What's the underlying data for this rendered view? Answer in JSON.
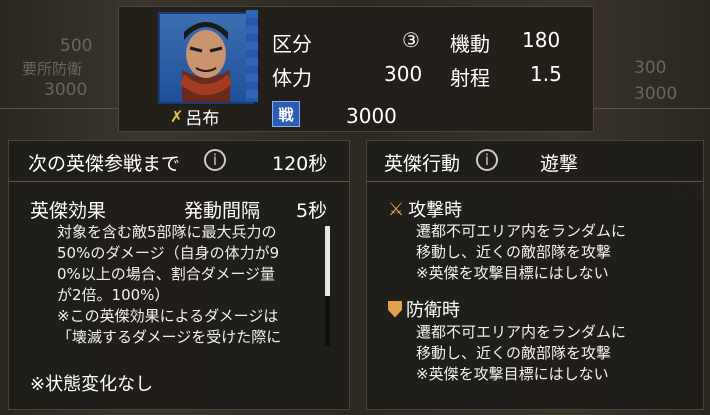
{
  "top": {
    "class_label": "区分",
    "class_value": "③",
    "mobility_label": "機動",
    "mobility_value": "180",
    "hp_label": "体力",
    "hp_value": "300",
    "range_label": "射程",
    "range_value": "1.5",
    "unit_name": "呂布",
    "war_badge": "戦",
    "war_value": "3000"
  },
  "left_panel": {
    "header_label": "次の英傑参戦まで",
    "header_value": "120秒",
    "effect_title": "英傑効果",
    "interval_label": "発動間隔",
    "interval_value": "5秒",
    "desc_lines": [
      "対象を含む敵5部隊に最大兵力の",
      "50%のダメージ（自身の体力が9",
      "0%以上の場合、割合ダメージ量",
      "が2倍。100%）",
      "※この英傑効果によるダメージは",
      "「壊滅するダメージを受けた際に"
    ],
    "status_note": "※状態変化なし"
  },
  "right_panel": {
    "header_label": "英傑行動",
    "header_value": "遊撃",
    "attack_title": "攻撃時",
    "attack_lines": [
      "遷都不可エリア内をランダムに",
      "移動し、近くの敵部隊を攻撃",
      "※英傑を攻撃目標にはしない"
    ],
    "defense_title": "防衛時",
    "defense_lines": [
      "遷都不可エリア内をランダムに",
      "移動し、近くの敵部隊を攻撃",
      "※英傑を攻撃目標にはしない"
    ]
  },
  "ghost": {
    "left_top": "500",
    "left_mid": "要所防衛",
    "left_low": "3000",
    "right_top": "300",
    "right_low": "3000",
    "right_mid": "120"
  },
  "icons": {
    "unit_cross": "crossed-weapons-icon",
    "attack": "sword-icon",
    "defense": "shield-icon",
    "info": "info-icon"
  }
}
